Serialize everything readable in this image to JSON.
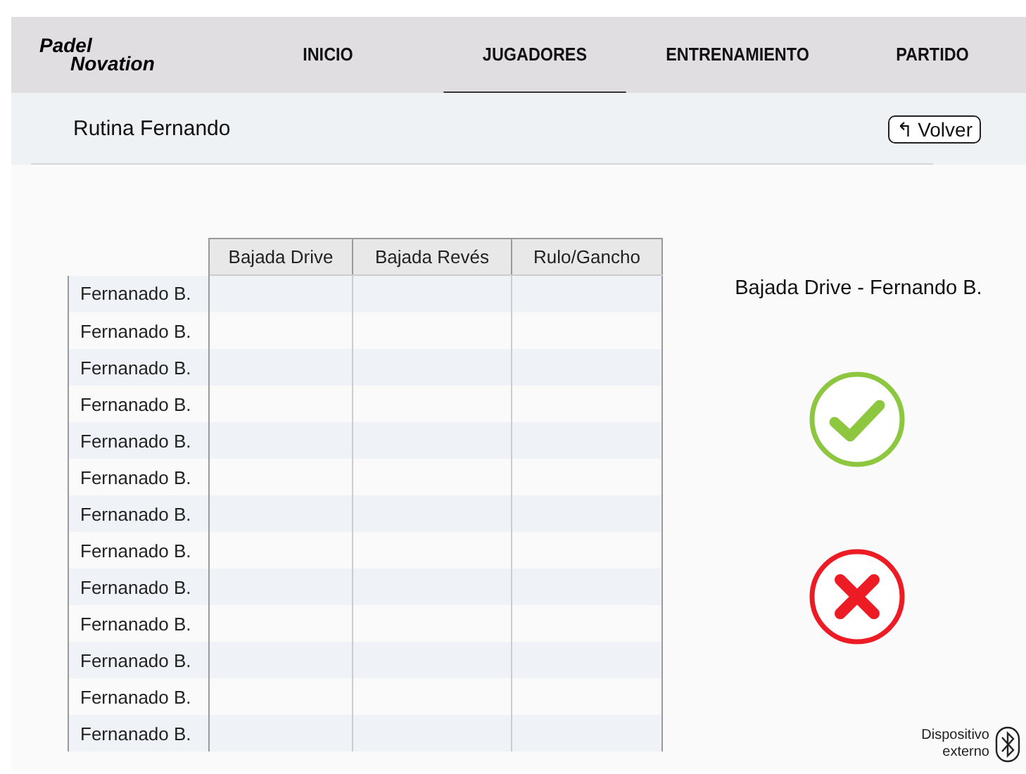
{
  "logo": {
    "top": "Padel",
    "bottom": "Novation"
  },
  "tabs": [
    {
      "label": "INICIO",
      "selected": false
    },
    {
      "label": "JUGADORES",
      "selected": true
    },
    {
      "label": "ENTRENAMIENTO",
      "selected": false
    },
    {
      "label": "PARTIDO",
      "selected": false
    }
  ],
  "page_title": "Rutina Fernando",
  "back_button": {
    "icon": "↰",
    "label": "Volver"
  },
  "table": {
    "columns": [
      "Bajada Drive",
      "Bajada Revés",
      "Rulo/Gancho"
    ],
    "rows": [
      "Fernanado B.",
      "Fernanado B.",
      "Fernanado B.",
      "Fernanado B.",
      "Fernanado B.",
      "Fernanado B.",
      "Fernanado B.",
      "Fernanado B.",
      "Fernanado B.",
      "Fernanado B.",
      "Fernanado B.",
      "Fernanado B.",
      "Fernanado B."
    ]
  },
  "evaluation": {
    "title": "Bajada Drive - Fernando B."
  },
  "device": {
    "label_line1": "Dispositivo",
    "label_line2": "externo"
  }
}
